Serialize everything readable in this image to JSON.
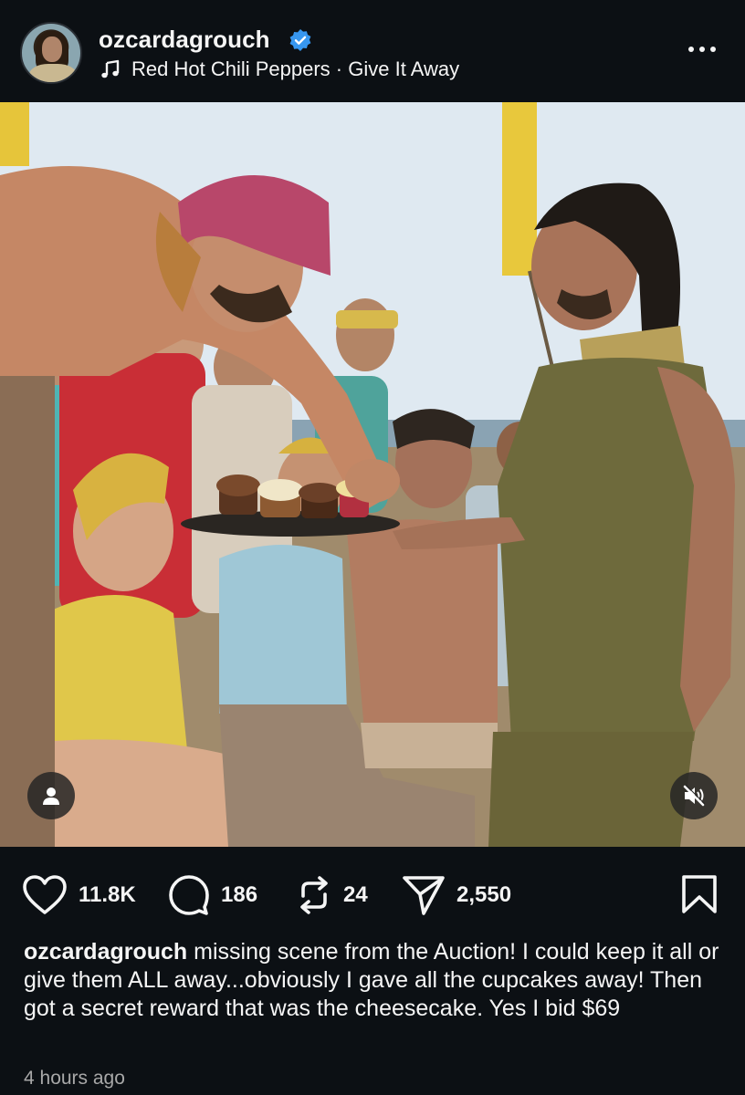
{
  "post": {
    "username": "ozcardagrouch",
    "verified": true,
    "audio": {
      "artist": "Red Hot Chili Peppers",
      "separator": "·",
      "track": "Give It Away"
    },
    "media_type": "video",
    "muted": true
  },
  "actions": {
    "likes": "11.8K",
    "comments": "186",
    "reposts": "24",
    "shares": "2,550"
  },
  "caption": {
    "username": "ozcardagrouch",
    "text": "missing scene from the Auction! I could keep it all or give them ALL away...obviously I gave all the cupcakes away! Then got a secret reward that was the cheesecake. Yes I bid $69"
  },
  "timestamp": "4 hours ago",
  "colors": {
    "background": "#0c1014",
    "text": "#f5f5f5",
    "verified_badge": "#3797f0",
    "muted_text": "#a8a8a8"
  },
  "icons": [
    "verified-badge-icon",
    "music-note-icon",
    "more-options-icon",
    "user-tag-icon",
    "mute-icon",
    "heart-icon",
    "comment-icon",
    "repost-icon",
    "share-icon",
    "bookmark-icon"
  ]
}
